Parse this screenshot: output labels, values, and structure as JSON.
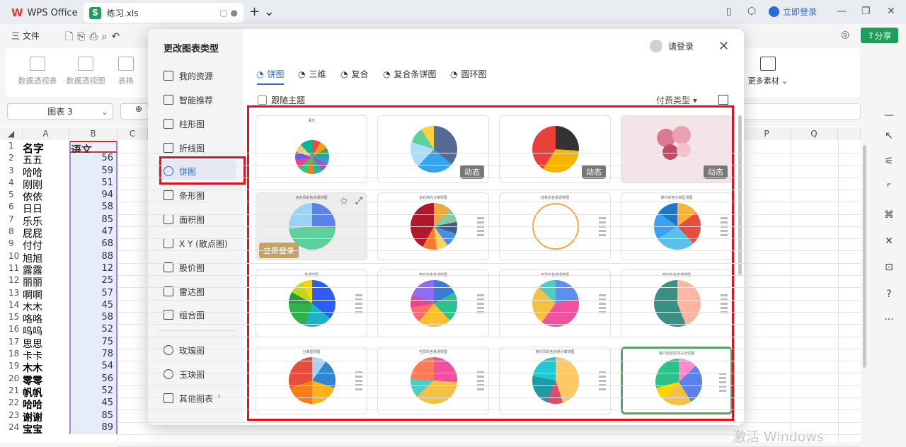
{
  "titlebar": {
    "app_name": "WPS Office",
    "file_name": "练习.xls",
    "login": "立即登录"
  },
  "menubar": {
    "file_menu": "三 文件",
    "share": "分享"
  },
  "ribbon": {
    "items": [
      "数据透视表",
      "数据透视图",
      "表格"
    ],
    "more": "更多素材"
  },
  "namebox": {
    "value": "图表 3"
  },
  "sheet": {
    "columns": [
      "A",
      "B",
      "C",
      "P",
      "Q"
    ],
    "header_row": {
      "a": "名字",
      "b": "语文"
    },
    "rows": [
      {
        "n": "2",
        "a": "五五",
        "b": "56"
      },
      {
        "n": "3",
        "a": "哈哈",
        "b": "59"
      },
      {
        "n": "4",
        "a": "刚刚",
        "b": "51"
      },
      {
        "n": "5",
        "a": "依依",
        "b": "94"
      },
      {
        "n": "6",
        "a": "日日",
        "b": "58"
      },
      {
        "n": "7",
        "a": "乐乐",
        "b": "85"
      },
      {
        "n": "8",
        "a": "屁屁",
        "b": "47"
      },
      {
        "n": "9",
        "a": "付付",
        "b": "68"
      },
      {
        "n": "10",
        "a": "旭旭",
        "b": "88"
      },
      {
        "n": "11",
        "a": "露露",
        "b": "12"
      },
      {
        "n": "12",
        "a": "丽丽",
        "b": "25"
      },
      {
        "n": "13",
        "a": "啊啊",
        "b": "57"
      },
      {
        "n": "14",
        "a": "木木",
        "b": "45"
      },
      {
        "n": "15",
        "a": "咯咯",
        "b": "58"
      },
      {
        "n": "16",
        "a": "呜呜",
        "b": "52"
      },
      {
        "n": "17",
        "a": "思思",
        "b": "75"
      },
      {
        "n": "18",
        "a": "卡卡",
        "b": "78"
      },
      {
        "n": "19",
        "a": "木木",
        "b": "54"
      },
      {
        "n": "20",
        "a": "零零",
        "b": "56"
      },
      {
        "n": "21",
        "a": "帆帆",
        "b": "52"
      },
      {
        "n": "22",
        "a": "哈哈",
        "b": "45"
      },
      {
        "n": "23",
        "a": "谢谢",
        "b": "85"
      },
      {
        "n": "24",
        "a": "宝宝",
        "b": "89"
      }
    ]
  },
  "dialog": {
    "title": "更改图表类型",
    "login": "请登录",
    "nav": [
      "我的资源",
      "智能推荐",
      "柱形图",
      "折线图",
      "饼图",
      "条形图",
      "面积图",
      "X Y (散点图)",
      "股价图",
      "雷达图",
      "组合图",
      "玫瑰图",
      "玉玦图",
      "其他图表"
    ],
    "tabs": [
      "饼图",
      "三维",
      "复合",
      "复合条饼图",
      "圆环图"
    ],
    "follow_theme": "跟随主题",
    "pay_type": "付费类型",
    "dynamic": "动态",
    "login_badge": "立即登录",
    "thumb_titles": [
      "语文",
      "",
      "",
      "",
      "商务风彩色普通饼图",
      "多彩简约分离饼图",
      "线条彩色普通饼图",
      "简约彩色分离型饼图",
      "普通饼图",
      "简约彩色普通饼图",
      "可爱彩色普通饼图",
      "简约彩色普通饼图",
      "分离型饼图",
      "可爱彩色普通饼图",
      "简约风彩色普通分离饼图",
      "客户回访情况占比饼图"
    ]
  },
  "watermark": "激活 Windows"
}
